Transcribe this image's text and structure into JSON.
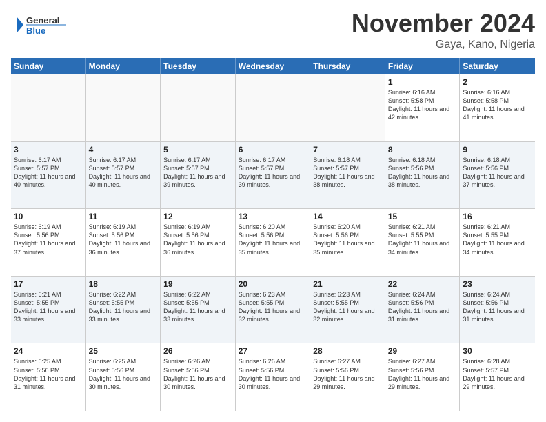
{
  "header": {
    "logo_line1": "General",
    "logo_line2": "Blue",
    "month_title": "November 2024",
    "location": "Gaya, Kano, Nigeria"
  },
  "days_of_week": [
    "Sunday",
    "Monday",
    "Tuesday",
    "Wednesday",
    "Thursday",
    "Friday",
    "Saturday"
  ],
  "weeks": [
    [
      {
        "day": "",
        "detail": ""
      },
      {
        "day": "",
        "detail": ""
      },
      {
        "day": "",
        "detail": ""
      },
      {
        "day": "",
        "detail": ""
      },
      {
        "day": "",
        "detail": ""
      },
      {
        "day": "1",
        "detail": "Sunrise: 6:16 AM\nSunset: 5:58 PM\nDaylight: 11 hours and 42 minutes."
      },
      {
        "day": "2",
        "detail": "Sunrise: 6:16 AM\nSunset: 5:58 PM\nDaylight: 11 hours and 41 minutes."
      }
    ],
    [
      {
        "day": "3",
        "detail": "Sunrise: 6:17 AM\nSunset: 5:57 PM\nDaylight: 11 hours and 40 minutes."
      },
      {
        "day": "4",
        "detail": "Sunrise: 6:17 AM\nSunset: 5:57 PM\nDaylight: 11 hours and 40 minutes."
      },
      {
        "day": "5",
        "detail": "Sunrise: 6:17 AM\nSunset: 5:57 PM\nDaylight: 11 hours and 39 minutes."
      },
      {
        "day": "6",
        "detail": "Sunrise: 6:17 AM\nSunset: 5:57 PM\nDaylight: 11 hours and 39 minutes."
      },
      {
        "day": "7",
        "detail": "Sunrise: 6:18 AM\nSunset: 5:57 PM\nDaylight: 11 hours and 38 minutes."
      },
      {
        "day": "8",
        "detail": "Sunrise: 6:18 AM\nSunset: 5:56 PM\nDaylight: 11 hours and 38 minutes."
      },
      {
        "day": "9",
        "detail": "Sunrise: 6:18 AM\nSunset: 5:56 PM\nDaylight: 11 hours and 37 minutes."
      }
    ],
    [
      {
        "day": "10",
        "detail": "Sunrise: 6:19 AM\nSunset: 5:56 PM\nDaylight: 11 hours and 37 minutes."
      },
      {
        "day": "11",
        "detail": "Sunrise: 6:19 AM\nSunset: 5:56 PM\nDaylight: 11 hours and 36 minutes."
      },
      {
        "day": "12",
        "detail": "Sunrise: 6:19 AM\nSunset: 5:56 PM\nDaylight: 11 hours and 36 minutes."
      },
      {
        "day": "13",
        "detail": "Sunrise: 6:20 AM\nSunset: 5:56 PM\nDaylight: 11 hours and 35 minutes."
      },
      {
        "day": "14",
        "detail": "Sunrise: 6:20 AM\nSunset: 5:56 PM\nDaylight: 11 hours and 35 minutes."
      },
      {
        "day": "15",
        "detail": "Sunrise: 6:21 AM\nSunset: 5:55 PM\nDaylight: 11 hours and 34 minutes."
      },
      {
        "day": "16",
        "detail": "Sunrise: 6:21 AM\nSunset: 5:55 PM\nDaylight: 11 hours and 34 minutes."
      }
    ],
    [
      {
        "day": "17",
        "detail": "Sunrise: 6:21 AM\nSunset: 5:55 PM\nDaylight: 11 hours and 33 minutes."
      },
      {
        "day": "18",
        "detail": "Sunrise: 6:22 AM\nSunset: 5:55 PM\nDaylight: 11 hours and 33 minutes."
      },
      {
        "day": "19",
        "detail": "Sunrise: 6:22 AM\nSunset: 5:55 PM\nDaylight: 11 hours and 33 minutes."
      },
      {
        "day": "20",
        "detail": "Sunrise: 6:23 AM\nSunset: 5:55 PM\nDaylight: 11 hours and 32 minutes."
      },
      {
        "day": "21",
        "detail": "Sunrise: 6:23 AM\nSunset: 5:55 PM\nDaylight: 11 hours and 32 minutes."
      },
      {
        "day": "22",
        "detail": "Sunrise: 6:24 AM\nSunset: 5:56 PM\nDaylight: 11 hours and 31 minutes."
      },
      {
        "day": "23",
        "detail": "Sunrise: 6:24 AM\nSunset: 5:56 PM\nDaylight: 11 hours and 31 minutes."
      }
    ],
    [
      {
        "day": "24",
        "detail": "Sunrise: 6:25 AM\nSunset: 5:56 PM\nDaylight: 11 hours and 31 minutes."
      },
      {
        "day": "25",
        "detail": "Sunrise: 6:25 AM\nSunset: 5:56 PM\nDaylight: 11 hours and 30 minutes."
      },
      {
        "day": "26",
        "detail": "Sunrise: 6:26 AM\nSunset: 5:56 PM\nDaylight: 11 hours and 30 minutes."
      },
      {
        "day": "27",
        "detail": "Sunrise: 6:26 AM\nSunset: 5:56 PM\nDaylight: 11 hours and 30 minutes."
      },
      {
        "day": "28",
        "detail": "Sunrise: 6:27 AM\nSunset: 5:56 PM\nDaylight: 11 hours and 29 minutes."
      },
      {
        "day": "29",
        "detail": "Sunrise: 6:27 AM\nSunset: 5:56 PM\nDaylight: 11 hours and 29 minutes."
      },
      {
        "day": "30",
        "detail": "Sunrise: 6:28 AM\nSunset: 5:57 PM\nDaylight: 11 hours and 29 minutes."
      }
    ]
  ]
}
